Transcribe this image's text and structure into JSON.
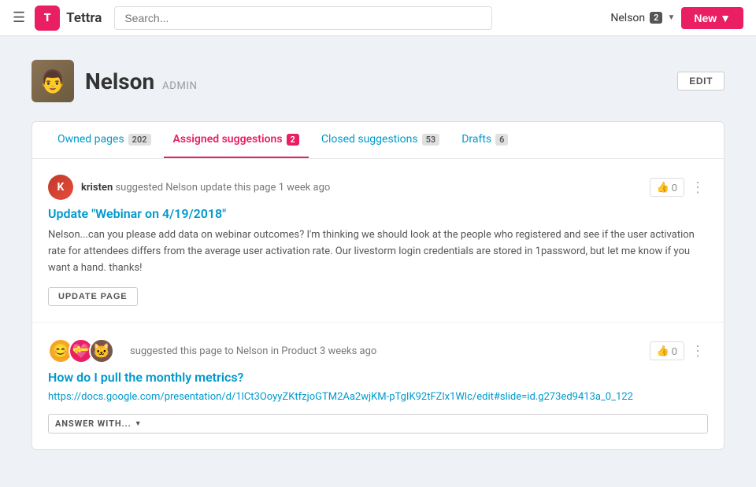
{
  "app": {
    "name": "Tettra",
    "logo_letter": "T"
  },
  "nav": {
    "search_placeholder": "Search...",
    "user_name": "Nelson",
    "user_badge": "2",
    "new_button": "New"
  },
  "profile": {
    "name": "Nelson",
    "role": "ADMIN",
    "edit_label": "EDIT",
    "avatar_emoji": "👨"
  },
  "tabs": [
    {
      "id": "owned",
      "label": "Owned pages",
      "count": "202",
      "active": false
    },
    {
      "id": "assigned",
      "label": "Assigned suggestions",
      "count": "2",
      "active": true
    },
    {
      "id": "closed",
      "label": "Closed suggestions",
      "count": "53",
      "active": false
    },
    {
      "id": "drafts",
      "label": "Drafts",
      "count": "6",
      "active": false
    }
  ],
  "suggestions": [
    {
      "id": 1,
      "author": "kristen",
      "meta": "suggested Nelson update this page 1 week ago",
      "title": "Update \"Webinar on 4/19/2018\"",
      "body": "Nelson...can you please add data on webinar outcomes? I'm thinking we should look at the people who registered and see if the user activation rate for attendees differs from the average user activation rate. Our livestorm login credentials are stored in 1password, but let me know if you want a hand. thanks!",
      "link": null,
      "like_count": "0",
      "action_label": "UPDATE PAGE",
      "action_type": "button"
    },
    {
      "id": 2,
      "author_emojis": "😊💝🐱",
      "meta": "suggested this page to Nelson in Product 3 weeks ago",
      "title": "How do I pull the monthly metrics?",
      "link": "https://docs.google.com/presentation/d/1lCt3OoyyZKtfzjoGTM2Aa2wjKM-pTgIK92tFZlx1Wlc/edit#slide=id.g273ed9413a_0_122",
      "like_count": "0",
      "action_label": "ANSWER WITH...",
      "action_type": "dropdown"
    }
  ]
}
